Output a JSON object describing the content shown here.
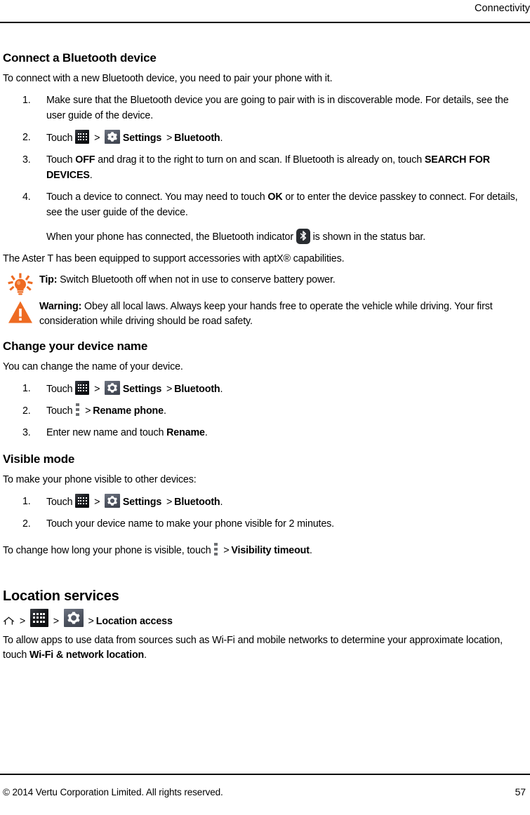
{
  "header": {
    "title": "Connectivity"
  },
  "sections": {
    "connect": {
      "heading": "Connect a Bluetooth device",
      "intro": "To connect with a new Bluetooth device, you need to pair your phone with it.",
      "step1": "Make sure that the Bluetooth device you are going to pair with is in discoverable mode. For details, see the user guide of the device.",
      "step2_prefix": "Touch",
      "step2_settings": "Settings",
      "step2_bluetooth": "Bluetooth",
      "step2_suffix": ".",
      "step3_a": "Touch ",
      "step3_off": "OFF",
      "step3_b": " and drag it to the right to turn on and scan. If Bluetooth is already on, touch ",
      "step3_search": "SEARCH FOR DEVICES",
      "step3_c": ".",
      "step4_a": "Touch a device to connect. You may need to touch ",
      "step4_ok": "OK",
      "step4_b": " or to enter the device passkey to connect. For details, see the user guide of the device.",
      "note_a": "When your phone has connected, the Bluetooth indicator",
      "note_b": "is shown in the status bar.",
      "aptx": "The Aster T has been equipped to support accessories with aptX® capabilities.",
      "tip_label": "Tip:",
      "tip_text": "Switch Bluetooth off when not in use to conserve battery power.",
      "warning_label": "Warning:",
      "warning_text": "Obey all local laws. Always keep your hands free to operate the vehicle while driving. Your first consideration while driving should be road safety."
    },
    "rename": {
      "heading": "Change your device name",
      "intro": "You can change the name of your device.",
      "step1_prefix": "Touch",
      "step1_settings": "Settings",
      "step1_bluetooth": "Bluetooth",
      "step2_prefix": "Touch",
      "step2_item": "Rename phone",
      "step3_a": "Enter new name and touch ",
      "step3_bold": "Rename",
      "step3_b": "."
    },
    "visible": {
      "heading": "Visible mode",
      "intro": "To make your phone visible to other devices:",
      "step1_prefix": "Touch",
      "step1_settings": "Settings",
      "step1_bluetooth": "Bluetooth",
      "step2": "Touch your device name to make your phone visible for 2 minutes.",
      "timeout_a": "To change how long your phone is visible, touch",
      "timeout_bold": "Visibility timeout",
      "timeout_b": "."
    },
    "location": {
      "heading": "Location services",
      "breadcrumb_item": "Location access",
      "body_a": "To allow apps to use data from sources such as Wi-Fi and mobile networks to determine your approximate location, touch ",
      "body_bold": "Wi-Fi & network location",
      "body_b": "."
    }
  },
  "footer": {
    "copyright": "© 2014 Vertu Corporation Limited. All rights reserved.",
    "page_number": "57"
  },
  "icons": {
    "apps": "apps-grid-icon",
    "settings": "settings-gear-icon",
    "menu": "overflow-menu-icon",
    "bluetooth": "bluetooth-indicator-icon",
    "home": "home-icon",
    "tip": "tip-lightbulb-icon",
    "warning": "warning-triangle-icon"
  },
  "colors": {
    "accent": "#ee6b22",
    "text": "#000000",
    "icon_dark": "#15171b",
    "icon_grey": "#545a67"
  }
}
